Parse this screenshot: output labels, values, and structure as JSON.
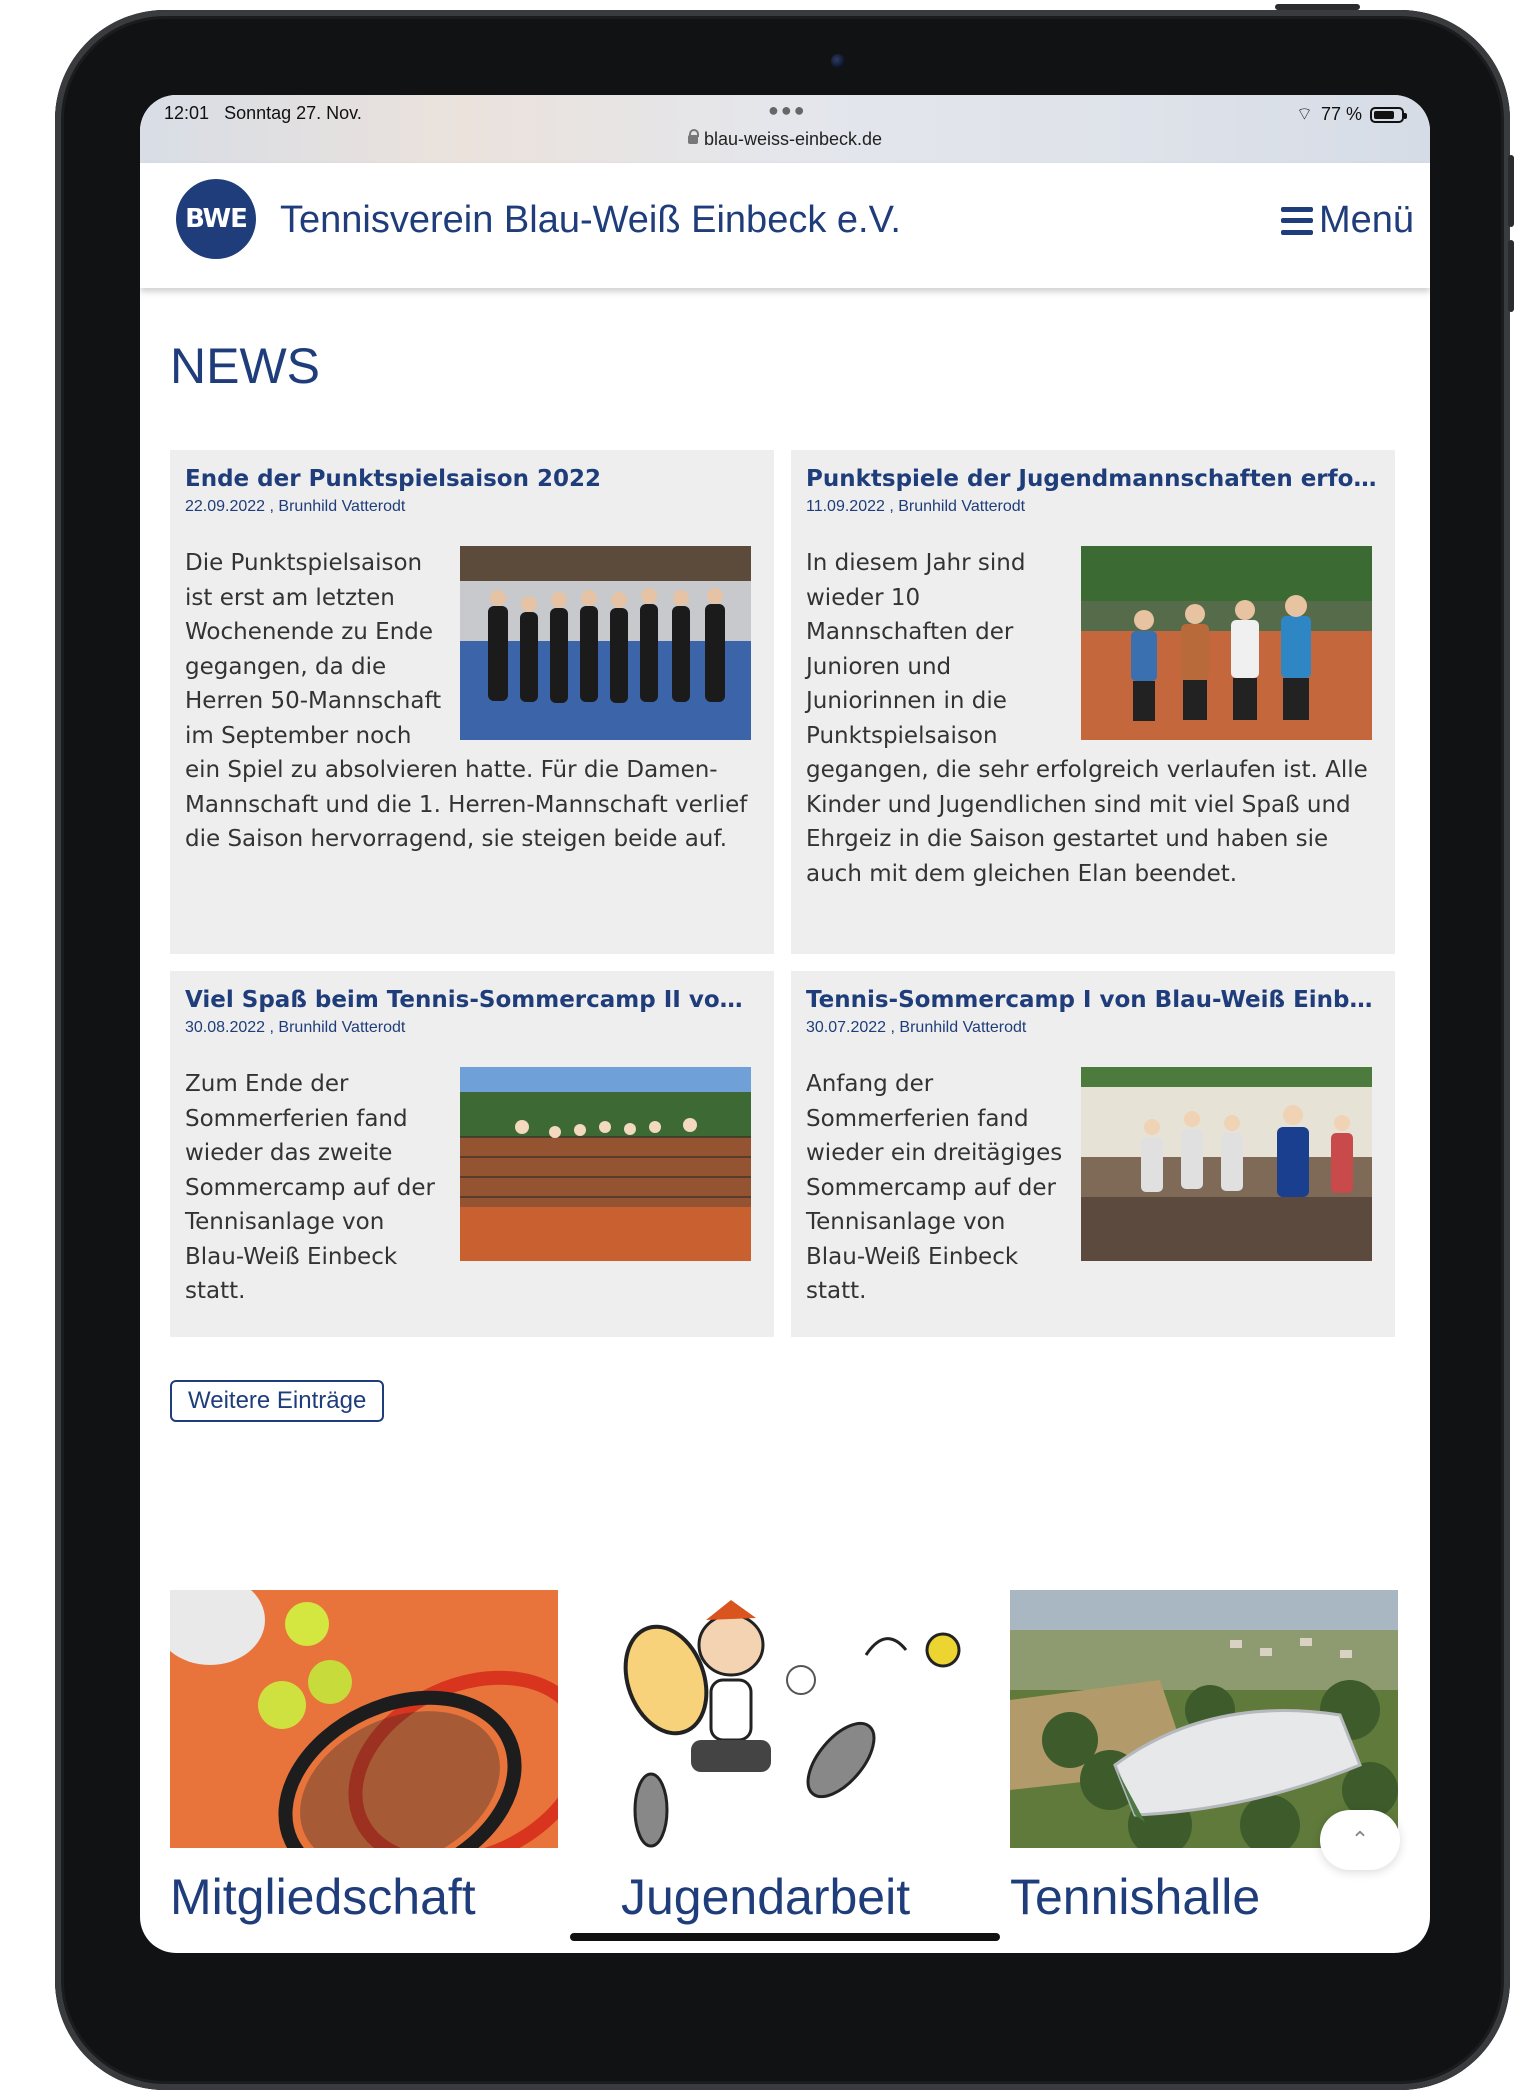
{
  "statusbar": {
    "time": "12:01",
    "date": "Sonntag 27. Nov.",
    "battery_text": "77 %",
    "battery_level": 0.77
  },
  "browser": {
    "url": "blau-weiss-einbeck.de"
  },
  "site": {
    "title": "Tennisverein Blau-Weiß Einbeck e.V.",
    "logo_text": "BWE",
    "menu_label": "Menü"
  },
  "news": {
    "heading": "NEWS",
    "articles": [
      {
        "title": "Ende der Punktspielsaison 2022",
        "meta": "22.09.2022 , Brunhild Vatterodt",
        "text": "Die Punktspielsaison ist erst am letzten Wochenende zu Ende gegangen, da die Herren 50-Mannschaft im September noch ein Spiel zu absolvieren hatte. Für die Damen-Mannschaft und die 1. Herren-Mannschaft verlief die Saison hervorragend, sie steigen beide auf."
      },
      {
        "title": "Punktspiele der Jugendmannschaften erfolgreich",
        "meta": "11.09.2022 , Brunhild Vatterodt",
        "text": "In diesem Jahr sind wieder 10 Mannschaften der Junioren und Juniorinnen in die Punktspielsaison gegangen, die sehr erfolgreich verlaufen ist. Alle Kinder und Jugendlichen sind mit viel Spaß und Ehrgeiz in die Saison gestartet und haben sie auch mit dem gleichen Elan beendet."
      },
      {
        "title": "Viel Spaß beim Tennis-Sommercamp II von Blau-Weiß Einbeck",
        "meta": "30.08.2022 , Brunhild Vatterodt",
        "text": "Zum Ende der Sommerferien fand wieder das zweite Sommercamp auf der Tennisanlage von Blau-Weiß Einbeck statt."
      },
      {
        "title": "Tennis-Sommercamp I von Blau-Weiß Einbeck",
        "meta": "30.07.2022 , Brunhild Vatterodt",
        "text": "Anfang der Sommerferien fand wieder ein dreitägiges Sommercamp auf der Tennisanlage von Blau-Weiß Einbeck statt."
      }
    ],
    "more_label": "Weitere Einträge"
  },
  "tiles": [
    {
      "label": "Mitgliedschaft"
    },
    {
      "label": "Jugendarbeit"
    },
    {
      "label": "Tennishalle"
    }
  ],
  "colors": {
    "brand_blue": "#1f3d7a",
    "card_bg": "#eeeeee"
  }
}
